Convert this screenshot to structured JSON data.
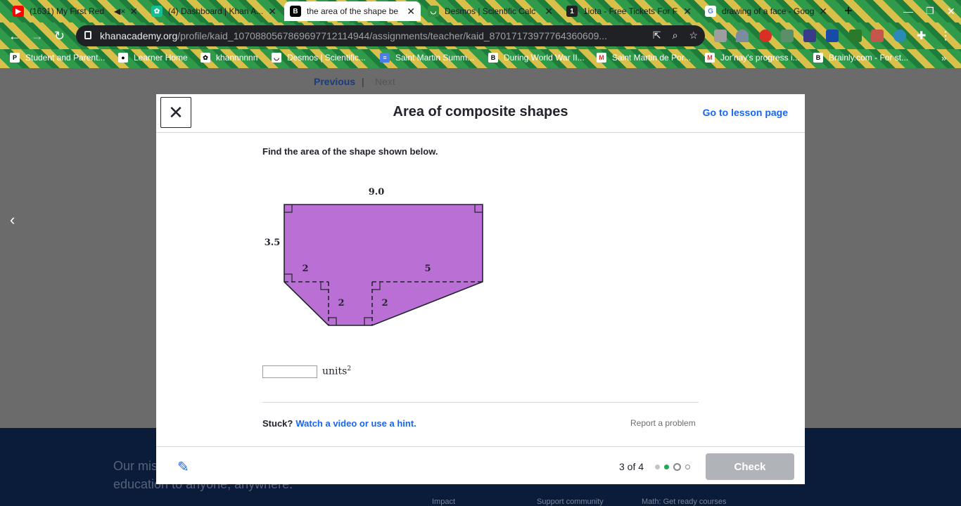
{
  "browser": {
    "tabs": [
      {
        "title": "(1631) My First Red",
        "icon": "youtube-icon",
        "color": "#ff0000"
      },
      {
        "title": "(4) Dashboard | Khan A...",
        "icon": "khan-academy-icon",
        "color": "#14bf96"
      },
      {
        "title": "the area of the shape be",
        "icon": "brainly-icon",
        "color": "#000000"
      },
      {
        "title": "Desmos | Scientific Calc",
        "icon": "desmos-icon",
        "color": "#2f8f3f"
      },
      {
        "title": "1iota - Free Tickets For F",
        "icon": "iota-icon",
        "color": "#222222"
      },
      {
        "title": "drawing of a face - Goog",
        "icon": "google-icon",
        "color": "#4285f4"
      }
    ],
    "url_host": "khanacademy.org",
    "url_path": "/profile/kaid_107088056786969771211494​4/assignments/teacher/kaid_870171739777643606​09...",
    "bookmarks": [
      "Student and Parent...",
      "Learner Home",
      "khannnnnn",
      "Desmos | Scientific...",
      "Saint Martin Summ...",
      "During World War II...",
      "Saint Martin de Por...",
      "Jor'nay's progress i...",
      "Brainly.com - For st..."
    ]
  },
  "background_page": {
    "prev": "Previous",
    "next": "Next",
    "footer_mission": "Our mis",
    "footer_mission2": "education to anyone, anywhere.",
    "footer_links": [
      "Impact",
      "Support community",
      "Math: Get ready courses"
    ]
  },
  "modal": {
    "title": "Area of composite shapes",
    "lesson_link": "Go to lesson page",
    "question": "Find the area of the shape shown below.",
    "figure_labels": {
      "top": "9.0",
      "left": "3.5",
      "left_bottom": "2",
      "right_bottom": "5",
      "notch_left": "2",
      "notch_right": "2"
    },
    "figure_color": "#b96fd4",
    "answer_value": "",
    "unit": "units",
    "unit_exp": "2",
    "stuck": "Stuck?",
    "hint_link": "Watch a video or use a hint.",
    "report": "Report a problem",
    "progress": "3 of 4",
    "check": "Check"
  }
}
